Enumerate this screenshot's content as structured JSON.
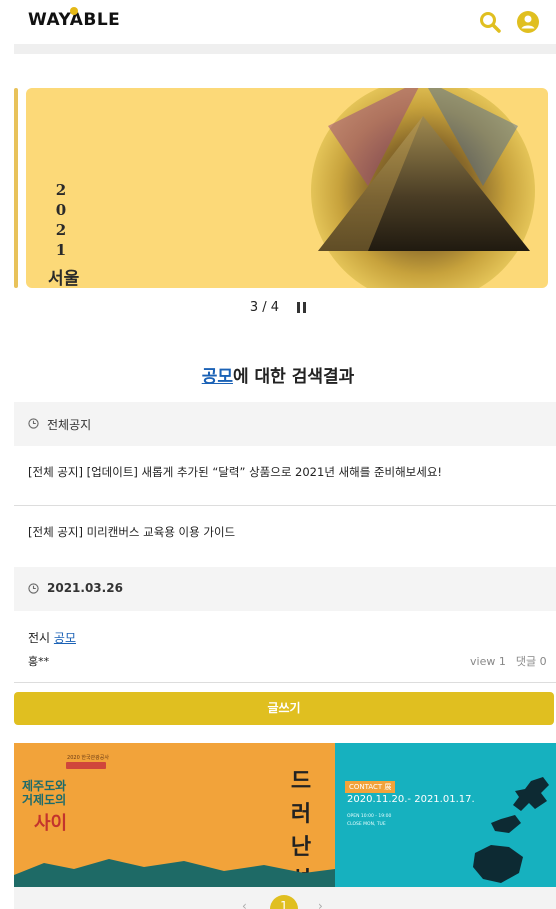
{
  "header": {
    "logo_text": "WAYABLE",
    "search_icon": "search-icon",
    "user_icon": "user-icon",
    "accent_color": "#e0bf20"
  },
  "carousel": {
    "slide_year": "2021",
    "slide_city": "서울",
    "counter": "3 / 4",
    "current": 3,
    "total": 4,
    "pause_icon": "pause-icon"
  },
  "results": {
    "keyword": "공모",
    "title_suffix": "에 대한 검색결과"
  },
  "notice_section": {
    "label": "전체공지",
    "items": [
      "[전체 공지] [업데이트] 새롭게 추가된 “달력” 상품으로 2021년 새해를 준비해보세요!",
      "[전체 공지] 미리캔버스 교육용 이용 가이드"
    ]
  },
  "date_section": {
    "date": "2021.03.26",
    "entry": {
      "title_prefix": "전시 ",
      "title_keyword": "공모",
      "author": "홍**",
      "views": "view 1",
      "comments": "댓글 0"
    }
  },
  "write_button": "글쓰기",
  "banner": {
    "left_small": "2020 한국관광공사",
    "left_title_line1": "제주도와",
    "left_title_line2": "거제도의",
    "left_title_sai": "사이",
    "left_vertical": [
      "드",
      "러",
      "난",
      "섬"
    ],
    "right_contact": "CONTACT 展",
    "right_date": "2020.11.20.- 2021.01.17.",
    "right_info_1": "OPEN  10:00 - 19:00",
    "right_info_2": "CLOSE  MON, TUE"
  },
  "pagination": {
    "current_page": "1",
    "prev_icon": "chevron-left-icon",
    "next_icon": "chevron-right-icon"
  }
}
